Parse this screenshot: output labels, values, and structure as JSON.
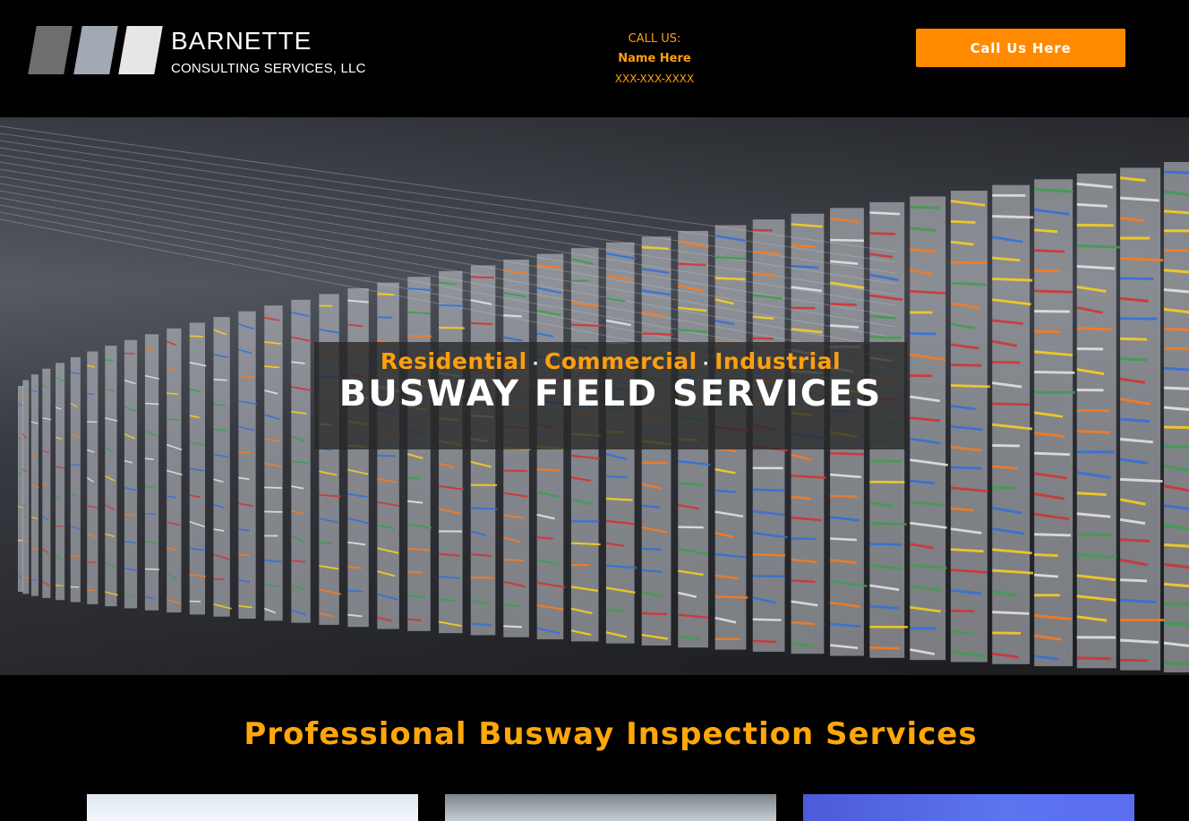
{
  "header": {
    "logo": {
      "name_line1": "BARNETTE",
      "name_line2": "CONSULTING SERVICES, LLC",
      "colors": [
        "#6e6e6e",
        "#a2a8b4",
        "#e6e6e6"
      ]
    },
    "call_label": "CALL US:",
    "contact_name": "Name Here",
    "phone": "XXX-XXX-XXXX",
    "cta_label": "Call Us Here"
  },
  "hero": {
    "sub_items": [
      "Residential",
      "Commercial",
      "Industrial"
    ],
    "separator": "·",
    "headline": "BUSWAY FIELD SERVICES"
  },
  "section": {
    "title": "Professional Busway Inspection Services"
  },
  "colors": {
    "accent": "#ff8a00",
    "accent_text": "#ffa70a",
    "background": "#000000"
  }
}
